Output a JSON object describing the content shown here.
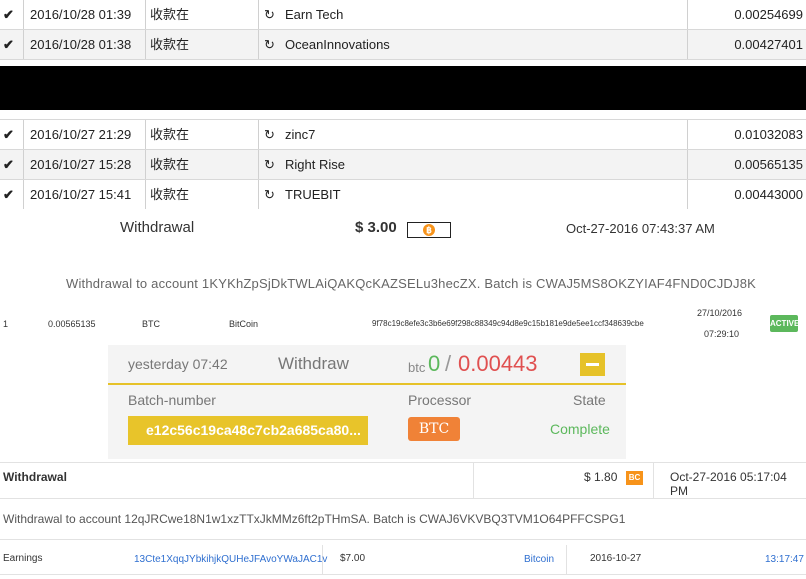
{
  "transactions": [
    {
      "date": "2016/10/28 01:39",
      "status": "收款在",
      "name": "Earn Tech",
      "amount": "0.00254699"
    },
    {
      "date": "2016/10/28 01:38",
      "status": "收款在",
      "name": "OceanInnovations",
      "amount": "0.00427401"
    },
    {
      "date": "2016/10/27 21:29",
      "status": "收款在",
      "name": "zinc7",
      "amount": "0.01032083"
    },
    {
      "date": "2016/10/27 15:28",
      "status": "收款在",
      "name": "Right Rise",
      "amount": "0.00565135"
    },
    {
      "date": "2016/10/27 15:41",
      "status": "收款在",
      "name": "TRUEBIT",
      "amount": "0.00443000"
    }
  ],
  "withdrawal1": {
    "label": "Withdrawal",
    "amount": "$ 3.00",
    "coin_symbol": "฿",
    "date": "Oct-27-2016 07:43:37 AM",
    "note": "Withdrawal to account 1KYKhZpSjDkTWLAiQAKQcKAZSELu3hecZX. Batch is CWAJ5MS8OKZYIAF4FND0CJDJ8K"
  },
  "small_row": {
    "index": "1",
    "amount": "0.00565135",
    "currency": "BTC",
    "method": "BitCoin",
    "hash": "9f78c19c8efe3c3b6e69f298c88349c94d8e9c15b181e9de5ee1ccf348639cbe",
    "date": "27/10/2016",
    "time": "07:29:10",
    "status": "ACTIVE"
  },
  "withdraw_card": {
    "time": "yesterday 07:42",
    "title": "Withdraw",
    "currency": "btc",
    "value_left": "0",
    "slash": "/",
    "value_right": "0.00443",
    "batch_label": "Batch-number",
    "processor_label": "Processor",
    "state_label": "State",
    "batch_number": "e12c56c19ca48c7cb2a685ca80...",
    "processor": "BTC",
    "state": "Complete"
  },
  "withdrawal2": {
    "label": "Withdrawal",
    "amount": "$ 1.80",
    "badge": "BC",
    "date": "Oct-27-2016 05:17:04 PM",
    "note": "Withdrawal to account 12qJRCwe18N1w1xzTTxJkMMz6ft2pTHmSA. Batch is CWAJ6VKVBQ3TVM1O64PFFCSPG1"
  },
  "earnings": {
    "label": "Earnings",
    "address": "13Cte1XqqJYbkihjkQUHeJFAvoYWaJAC1v",
    "amount": "$7.00",
    "method": "Bitcoin",
    "date": "2016-10-27",
    "time": "13:17:47"
  },
  "colors": {
    "accent_yellow": "#e6c229",
    "btc_orange": "#f7931a",
    "processor_orange": "#f08237",
    "complete_green": "#5cb85c",
    "amount_red": "#e05050",
    "link_blue": "#2f6fd0"
  }
}
